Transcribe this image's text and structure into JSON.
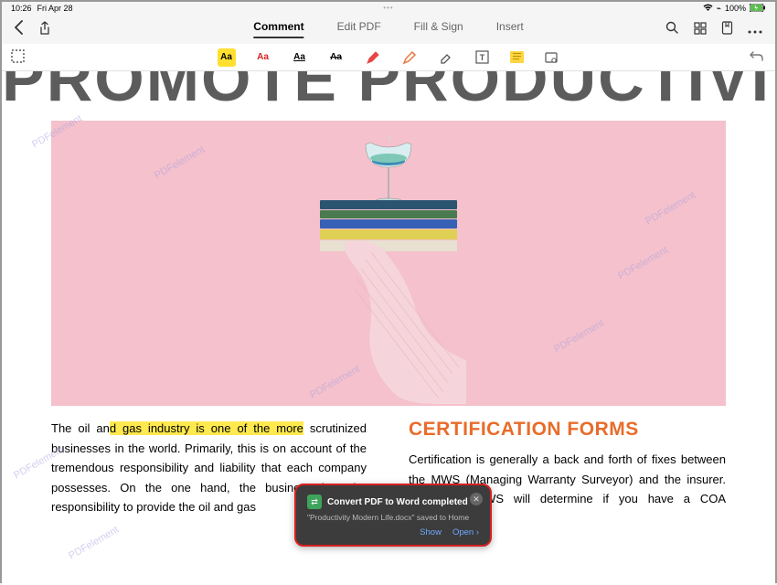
{
  "status": {
    "time": "10:26",
    "date": "Fri Apr 28",
    "battery": "100%"
  },
  "tabs": {
    "comment": "Comment",
    "edit": "Edit PDF",
    "fill": "Fill & Sign",
    "insert": "Insert"
  },
  "doc": {
    "title": "PROMOTE PRODUCTIVITY",
    "watermark": "PDFelement",
    "left_pre": "The oil an",
    "left_hl1": "d gas industry is ",
    "left_mid": "",
    "left_hl2": "one of the more",
    "left_post": " scrutinized businesses in the world. Primarily, this is on account of the tremendous responsibility and liability that each company possesses. On the one hand, the business has the responsibility to provide the oil and gas",
    "cert_heading": "CERTIFICATION FORMS",
    "right_body": "Certification is generally a back and forth of fixes between the MWS (Managing Warranty Surveyor) and the insurer. Since the MWS will determine if you have a COA (Certificate"
  },
  "notif": {
    "title": "Convert PDF to Word completed",
    "sub": "\"Productivity Modern Life.docx\" saved to Home",
    "show": "Show",
    "open": "Open"
  }
}
